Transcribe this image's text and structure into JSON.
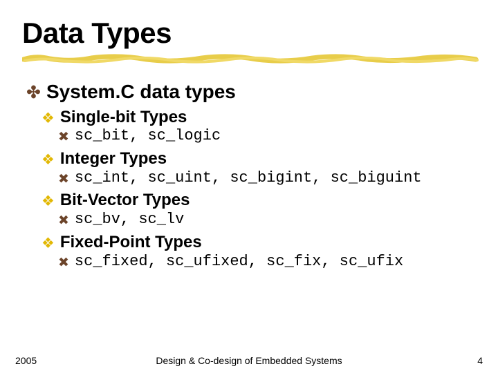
{
  "title": "Data Types",
  "bullets": {
    "level1": {
      "text": "System.C data types"
    },
    "level2": {
      "item0": "Single-bit Types",
      "item1": "Integer Types",
      "item2": "Bit-Vector Types",
      "item3": "Fixed-Point Types"
    },
    "level3": {
      "item0": "sc_bit, sc_logic",
      "item1": "sc_int, sc_uint, sc_bigint, sc_biguint",
      "item2": "sc_bv, sc_lv",
      "item3": "sc_fixed, sc_ufixed, sc_fix, sc_ufix"
    }
  },
  "footer": {
    "left": "2005",
    "center": "Design & Co-design of Embedded Systems",
    "right": "4"
  }
}
